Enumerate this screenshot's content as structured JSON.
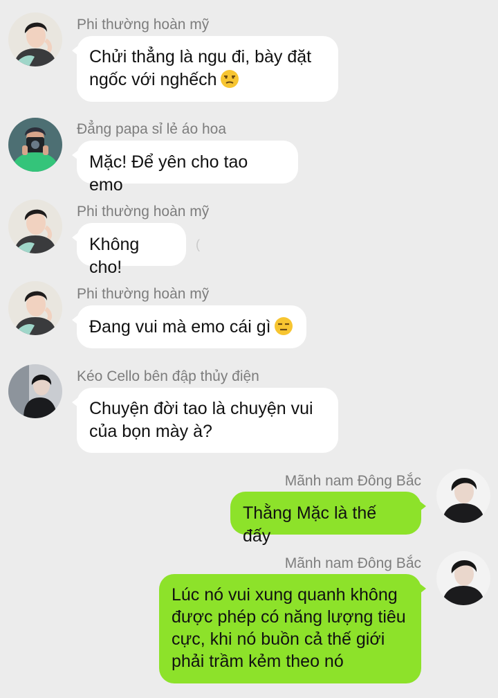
{
  "colors": {
    "background": "#ececec",
    "incoming_bubble": "#ffffff",
    "outgoing_bubble": "#8de22a",
    "sender_name": "#7d7d7d"
  },
  "messages": [
    {
      "sender": "Phi thường hoàn mỹ",
      "direction": "incoming",
      "avatar": "avatar-phi-thuong",
      "text": "Chửi thẳng là ngu đi, bày đặt\nngốc với nghếch",
      "emoji": "unamused-face-icon"
    },
    {
      "sender": "Đẳng papa sỉ lẻ áo hoa",
      "direction": "incoming",
      "avatar": "avatar-dang-papa",
      "text": "Mặc! Để yên cho tao emo",
      "emoji": ""
    },
    {
      "sender": "Phi thường hoàn mỹ",
      "direction": "incoming",
      "avatar": "avatar-phi-thuong",
      "text": "Không cho!",
      "emoji": ""
    },
    {
      "sender": "Phi thường hoàn mỹ",
      "direction": "incoming",
      "avatar": "avatar-phi-thuong",
      "text": "Đang vui mà emo cái gì",
      "emoji": "expressionless-face-icon"
    },
    {
      "sender": "Kéo Cello bên đập thủy điện",
      "direction": "incoming",
      "avatar": "avatar-keo-cello",
      "text": "Chuyện đời tao là chuyện vui\ncủa bọn mày à?",
      "emoji": ""
    },
    {
      "sender": "Mãnh nam Đông Bắc",
      "direction": "outgoing",
      "avatar": "avatar-manh-nam",
      "text": "Thằng Mặc là thế đấy",
      "emoji": ""
    },
    {
      "sender": "Mãnh nam Đông Bắc",
      "direction": "outgoing",
      "avatar": "avatar-manh-nam",
      "text": "Lúc nó vui xung quanh không\nđược phép có năng lượng tiêu\ncực, khi nó buồn cả thế giới\nphải trầm kẻm theo nó",
      "emoji": ""
    }
  ]
}
